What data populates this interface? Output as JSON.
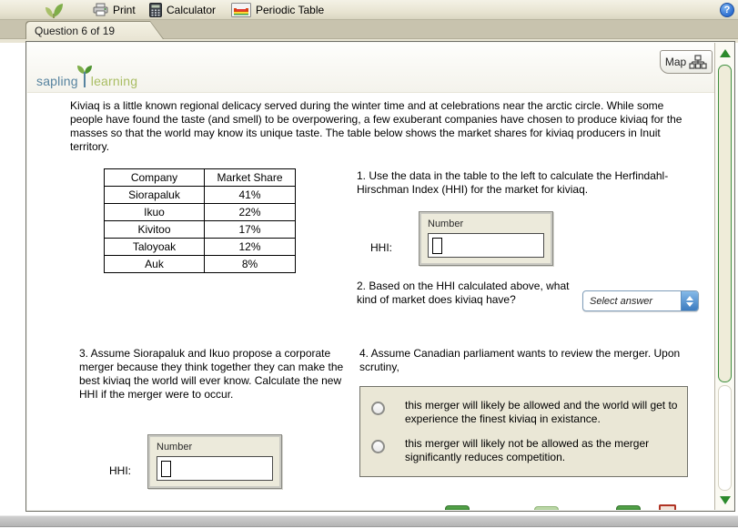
{
  "toolbar": {
    "print_label": "Print",
    "calculator_label": "Calculator",
    "periodic_table_label": "Periodic Table",
    "help_glyph": "?"
  },
  "tab": {
    "label": "Question 6 of 19"
  },
  "banner": {
    "logo_word1": "sapling",
    "logo_word2": "learning",
    "map_button_label": "Map"
  },
  "intro_text": "Kiviaq is a little known regional delicacy served during the winter time and at celebrations near the arctic circle. While some people have found the taste (and smell) to be overpowering, a few exuberant companies have chosen to produce kiviaq for the masses so that the world may know its unique taste. The table below shows the market shares for kiviaq producers in Inuit territory.",
  "market_table": {
    "headers": [
      "Company",
      "Market Share"
    ],
    "rows": [
      [
        "Siorapaluk",
        "41%"
      ],
      [
        "Ikuo",
        "22%"
      ],
      [
        "Kivitoo",
        "17%"
      ],
      [
        "Taloyoak",
        "12%"
      ],
      [
        "Auk",
        "8%"
      ]
    ]
  },
  "q1": {
    "text": "1. Use the data in the table to the left to calculate the Herfindahl-Hirschman Index (HHI) for the market for kiviaq.",
    "hhi_label": "HHI:",
    "input_type_label": "Number",
    "input_value": ""
  },
  "q2": {
    "text": "2. Based on the HHI calculated above, what kind of market does kiviaq have?",
    "dropdown_value": "Select answer"
  },
  "q3": {
    "text": "3. Assume Siorapaluk and Ikuo propose a corporate merger because they think together they can make the best kiviaq the world will ever know. Calculate the new HHI if the merger were to occur.",
    "hhi_label": "HHI:",
    "input_type_label": "Number",
    "input_value": ""
  },
  "q4": {
    "text": "4. Assume Canadian parliament wants to review the merger. Upon scrutiny,",
    "options": [
      "this merger will likely be allowed and the world will get to experience the finest kiviaq in existance.",
      "this merger will likely not be allowed as the merger significantly reduces competition."
    ],
    "selected_index": -1
  },
  "colors": {
    "toolbar_beige": "#e9e5d4",
    "scrollbar_green": "#2c8a2c",
    "dropdown_blue": "#3c7cc0",
    "help_blue": "#2e6fd0",
    "logo_blue": "#56839f",
    "logo_green": "#a9bd62"
  }
}
